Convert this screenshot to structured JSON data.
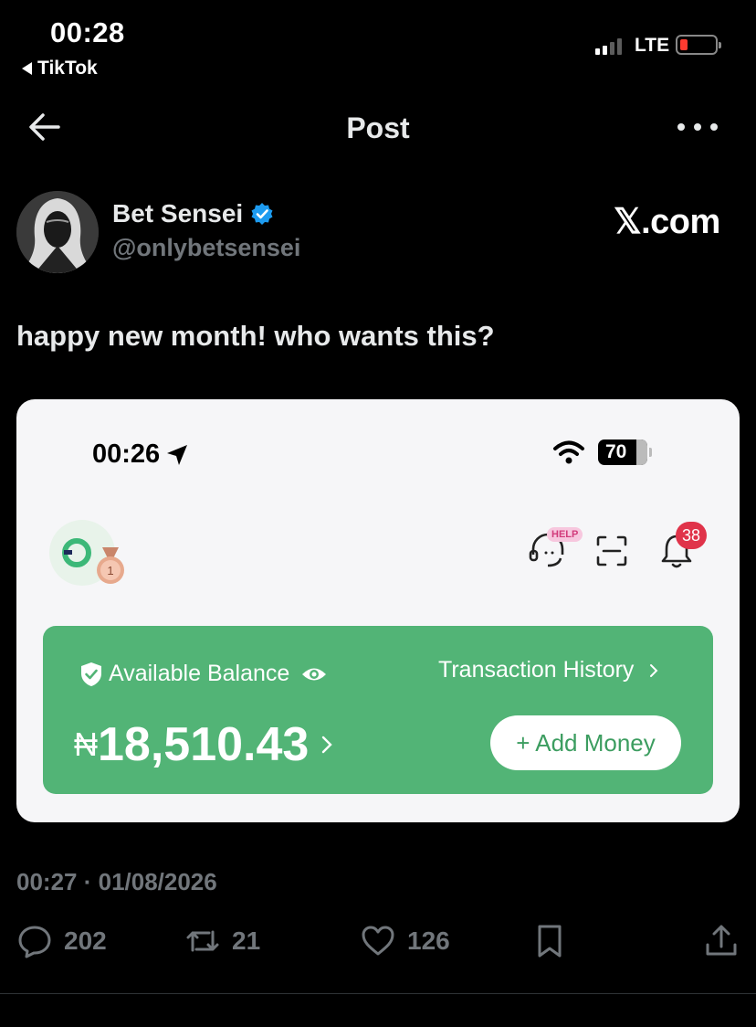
{
  "status_bar": {
    "time": "00:28",
    "back_app": "TikTok",
    "network": "LTE"
  },
  "header": {
    "title": "Post"
  },
  "author": {
    "name": "Bet Sensei",
    "handle": "@onlybetsensei",
    "watermark": "𝕏.com"
  },
  "post": {
    "text": "happy new month! who wants this?",
    "timestamp": "00:27 · 01/08/2026"
  },
  "embedded_screenshot": {
    "time": "00:26",
    "battery": "70",
    "help_badge": "HELP",
    "notification_count": "38",
    "medal_label": "1",
    "balance_label": "Available Balance",
    "transaction_history": "Transaction History",
    "currency": "₦",
    "balance_amount": "18,510.43",
    "add_money": "+ Add Money",
    "accent_color": "#52b476"
  },
  "actions": {
    "replies": "202",
    "reposts": "21",
    "likes": "126"
  }
}
